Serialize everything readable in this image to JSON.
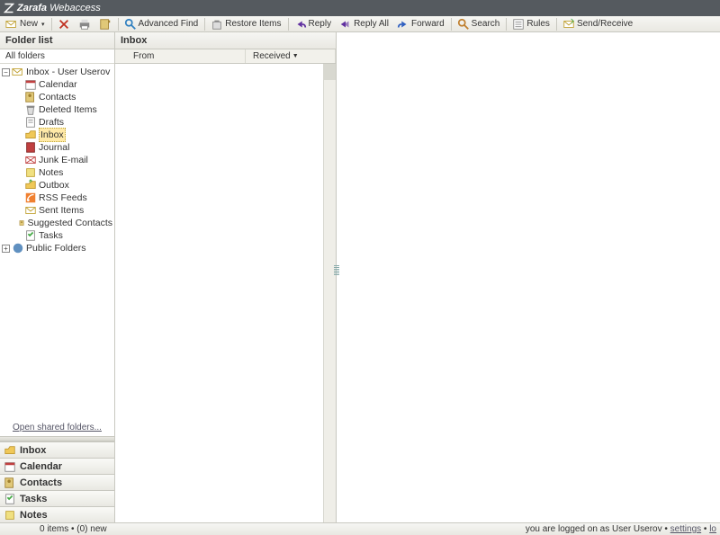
{
  "app": {
    "brand": "Zarafa",
    "product": "Webaccess"
  },
  "toolbar": {
    "new": "New",
    "advanced_find": "Advanced Find",
    "restore_items": "Restore Items",
    "reply": "Reply",
    "reply_all": "Reply All",
    "forward": "Forward",
    "search": "Search",
    "rules": "Rules",
    "send_receive": "Send/Receive"
  },
  "sidebar": {
    "title": "Folder list",
    "subtitle": "All folders",
    "root": "Inbox - User Userov",
    "folders": [
      {
        "icon": "calendar",
        "label": "Calendar"
      },
      {
        "icon": "contacts",
        "label": "Contacts"
      },
      {
        "icon": "trash",
        "label": "Deleted Items"
      },
      {
        "icon": "drafts",
        "label": "Drafts"
      },
      {
        "icon": "inbox",
        "label": "Inbox",
        "selected": true
      },
      {
        "icon": "journal",
        "label": "Journal"
      },
      {
        "icon": "junk",
        "label": "Junk E-mail"
      },
      {
        "icon": "notes",
        "label": "Notes"
      },
      {
        "icon": "outbox",
        "label": "Outbox"
      },
      {
        "icon": "rss",
        "label": "RSS Feeds"
      },
      {
        "icon": "sent",
        "label": "Sent Items"
      },
      {
        "icon": "contacts",
        "label": "Suggested Contacts"
      },
      {
        "icon": "tasks",
        "label": "Tasks"
      }
    ],
    "public_folders": "Public Folders",
    "open_shared": "Open shared folders...",
    "nav": [
      {
        "icon": "inbox",
        "label": "Inbox"
      },
      {
        "icon": "calendar",
        "label": "Calendar"
      },
      {
        "icon": "contacts",
        "label": "Contacts"
      },
      {
        "icon": "tasks",
        "label": "Tasks"
      },
      {
        "icon": "notes",
        "label": "Notes"
      }
    ]
  },
  "list": {
    "title": "Inbox",
    "col_from": "From",
    "col_received": "Received",
    "sort": "▼"
  },
  "status": {
    "left": "0 items • (0) new",
    "logged_prefix": "you are logged on as ",
    "user": "User Userov",
    "sep": " • ",
    "settings": "settings",
    "logout": "lo"
  }
}
